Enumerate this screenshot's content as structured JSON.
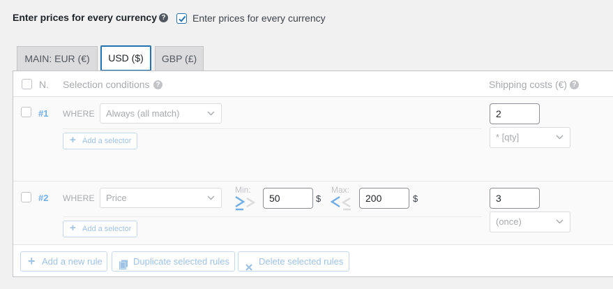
{
  "top": {
    "setting_label": "Enter prices for every currency",
    "help_glyph": "?",
    "checkbox_label": "Enter prices for every currency",
    "checkbox_checked": true
  },
  "tabs": [
    {
      "label": "MAIN: EUR (€)",
      "active": false
    },
    {
      "label": "USD ($)",
      "active": true
    },
    {
      "label": "GBP (£)",
      "active": false
    }
  ],
  "table": {
    "col_num": "N.",
    "col_conditions": "Selection conditions",
    "col_shipping": "Shipping costs (€)",
    "help_glyph": "?"
  },
  "rules": [
    {
      "number": "#1",
      "where": "WHERE",
      "condition": "Always (all match)",
      "add_selector": "Add a selector",
      "cost": "2",
      "cost_mode": "* [qty]"
    },
    {
      "number": "#2",
      "where": "WHERE",
      "condition": "Price",
      "min_label": "Min:",
      "min_value": "50",
      "min_unit": "$",
      "max_label": "Max:",
      "max_value": "200",
      "max_unit": "$",
      "add_selector": "Add a selector",
      "cost": "3",
      "cost_mode": "(once)"
    }
  ],
  "footer": {
    "add_rule": "Add a new rule",
    "duplicate": "Duplicate selected rules",
    "delete": "Delete selected rules"
  },
  "colors": {
    "accent": "#2271b1",
    "muted_blue": "#9ec2e6",
    "rule_number": "#72aee6"
  }
}
